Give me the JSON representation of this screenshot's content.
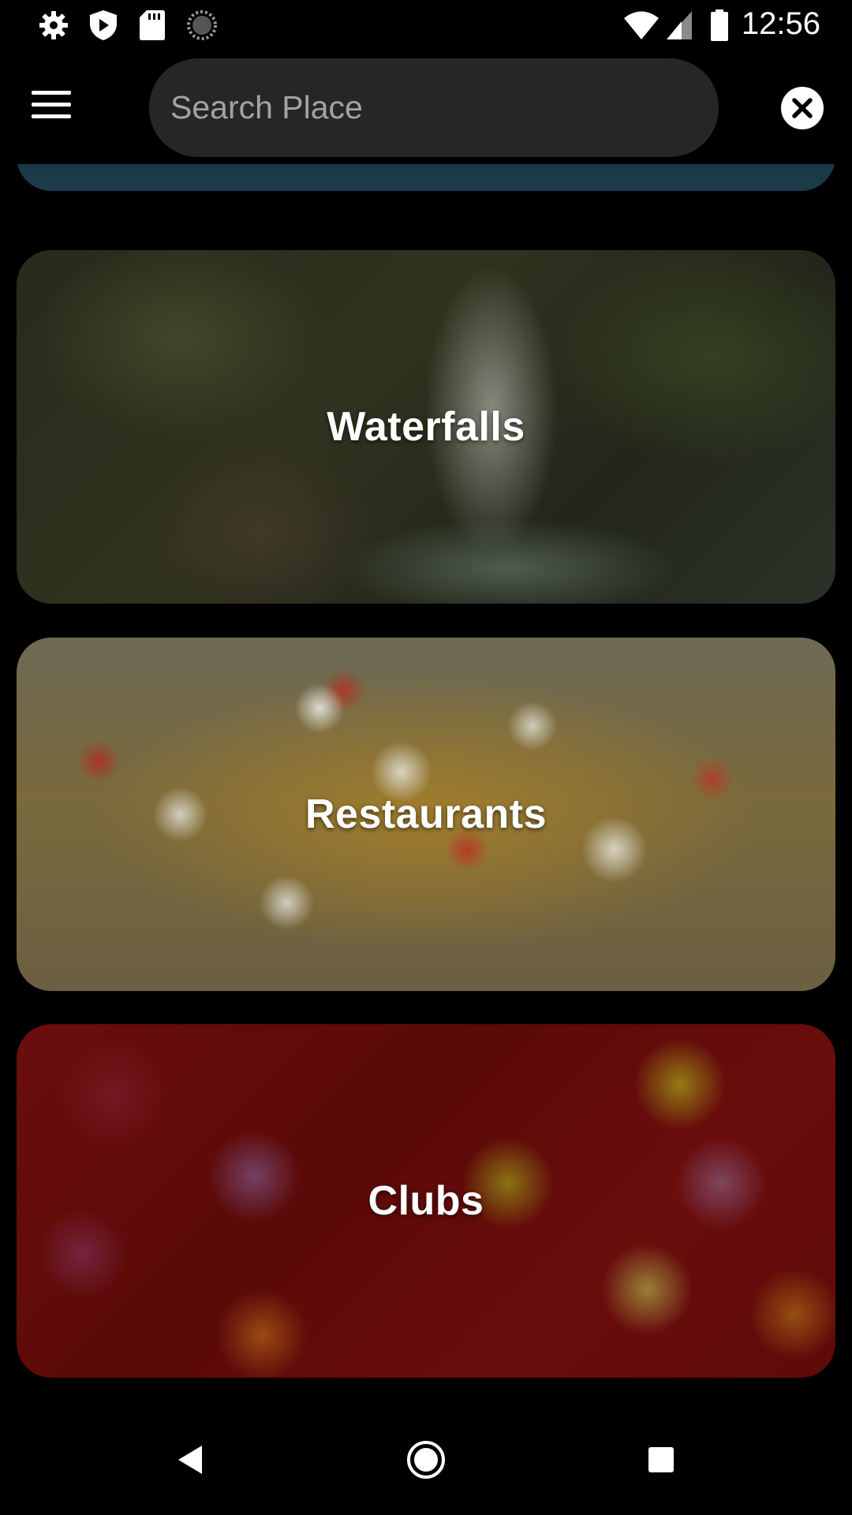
{
  "status_bar": {
    "time": "12:56",
    "left_icons": [
      "settings-gear-icon",
      "shield-icon",
      "sd-card-icon",
      "loading-spinner-icon"
    ],
    "right_icons": [
      "wifi-icon",
      "cell-signal-icon",
      "battery-icon"
    ]
  },
  "app_bar": {
    "menu_icon": "hamburger-menu-icon",
    "search": {
      "placeholder": "Search Place",
      "value": ""
    },
    "clear_icon": "close-icon"
  },
  "categories": [
    {
      "label": "",
      "image": "beach"
    },
    {
      "label": "Waterfalls",
      "image": "waterfall"
    },
    {
      "label": "Restaurants",
      "image": "nachos"
    },
    {
      "label": "Clubs",
      "image": "bokeh-lights"
    }
  ],
  "nav_bar": {
    "buttons": [
      "back-icon",
      "home-icon",
      "recents-icon"
    ]
  },
  "colors": {
    "background": "#000000",
    "search_field": "#262626",
    "text": "#ffffff",
    "placeholder": "#a3a3a3"
  }
}
